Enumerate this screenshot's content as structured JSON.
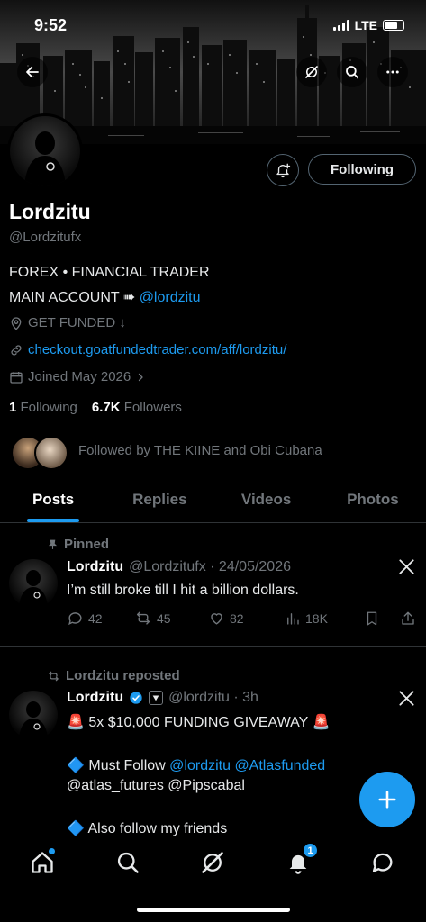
{
  "status_bar": {
    "time": "9:52",
    "network": "LTE"
  },
  "profile": {
    "name": "Lordzitu",
    "handle": "@Lordzitufx",
    "bio_line1": "FOREX • FINANCIAL TRADER",
    "bio_line2_prefix": "MAIN ACCOUNT ➠",
    "bio_line2_mention": "@lordzitu",
    "location": "GET FUNDED ↓",
    "website": "checkout.goatfundedtrader.com/aff/lordzitu/",
    "joined": "Joined May 2026",
    "following_count": "1",
    "following_label": "Following",
    "followers_count": "6.7K",
    "followers_label": "Followers",
    "followed_by": "Followed by THE KIINE and Obi Cubana",
    "follow_button": "Following"
  },
  "tabs": [
    "Posts",
    "Replies",
    "Videos",
    "Photos"
  ],
  "posts": [
    {
      "context": "Pinned",
      "name": "Lordzitu",
      "handle_date": "@Lordzitufx · 24/05/2026",
      "text": "I’m still broke till I hit a billion dollars.",
      "replies": "42",
      "reposts": "45",
      "likes": "82",
      "views": "18K"
    },
    {
      "context": "Lordzitu reposted",
      "name": "Lordzitu",
      "handle_date": "@lordzitu · 3h",
      "line1": "🚨 5x $10,000 FUNDING GIVEAWAY 🚨",
      "line2_prefix": "🔷 Must Follow",
      "line2_mentions": "@lordzitu @Atlasfunded",
      "line3_mentions": "@atlas_futures @Pipscabal",
      "line4": "🔷 Also follow my friends"
    }
  ],
  "bottom_nav": {
    "notification_badge": "1"
  },
  "colors": {
    "accent": "#1d9bf0",
    "background": "#000000",
    "muted": "#71767b"
  }
}
